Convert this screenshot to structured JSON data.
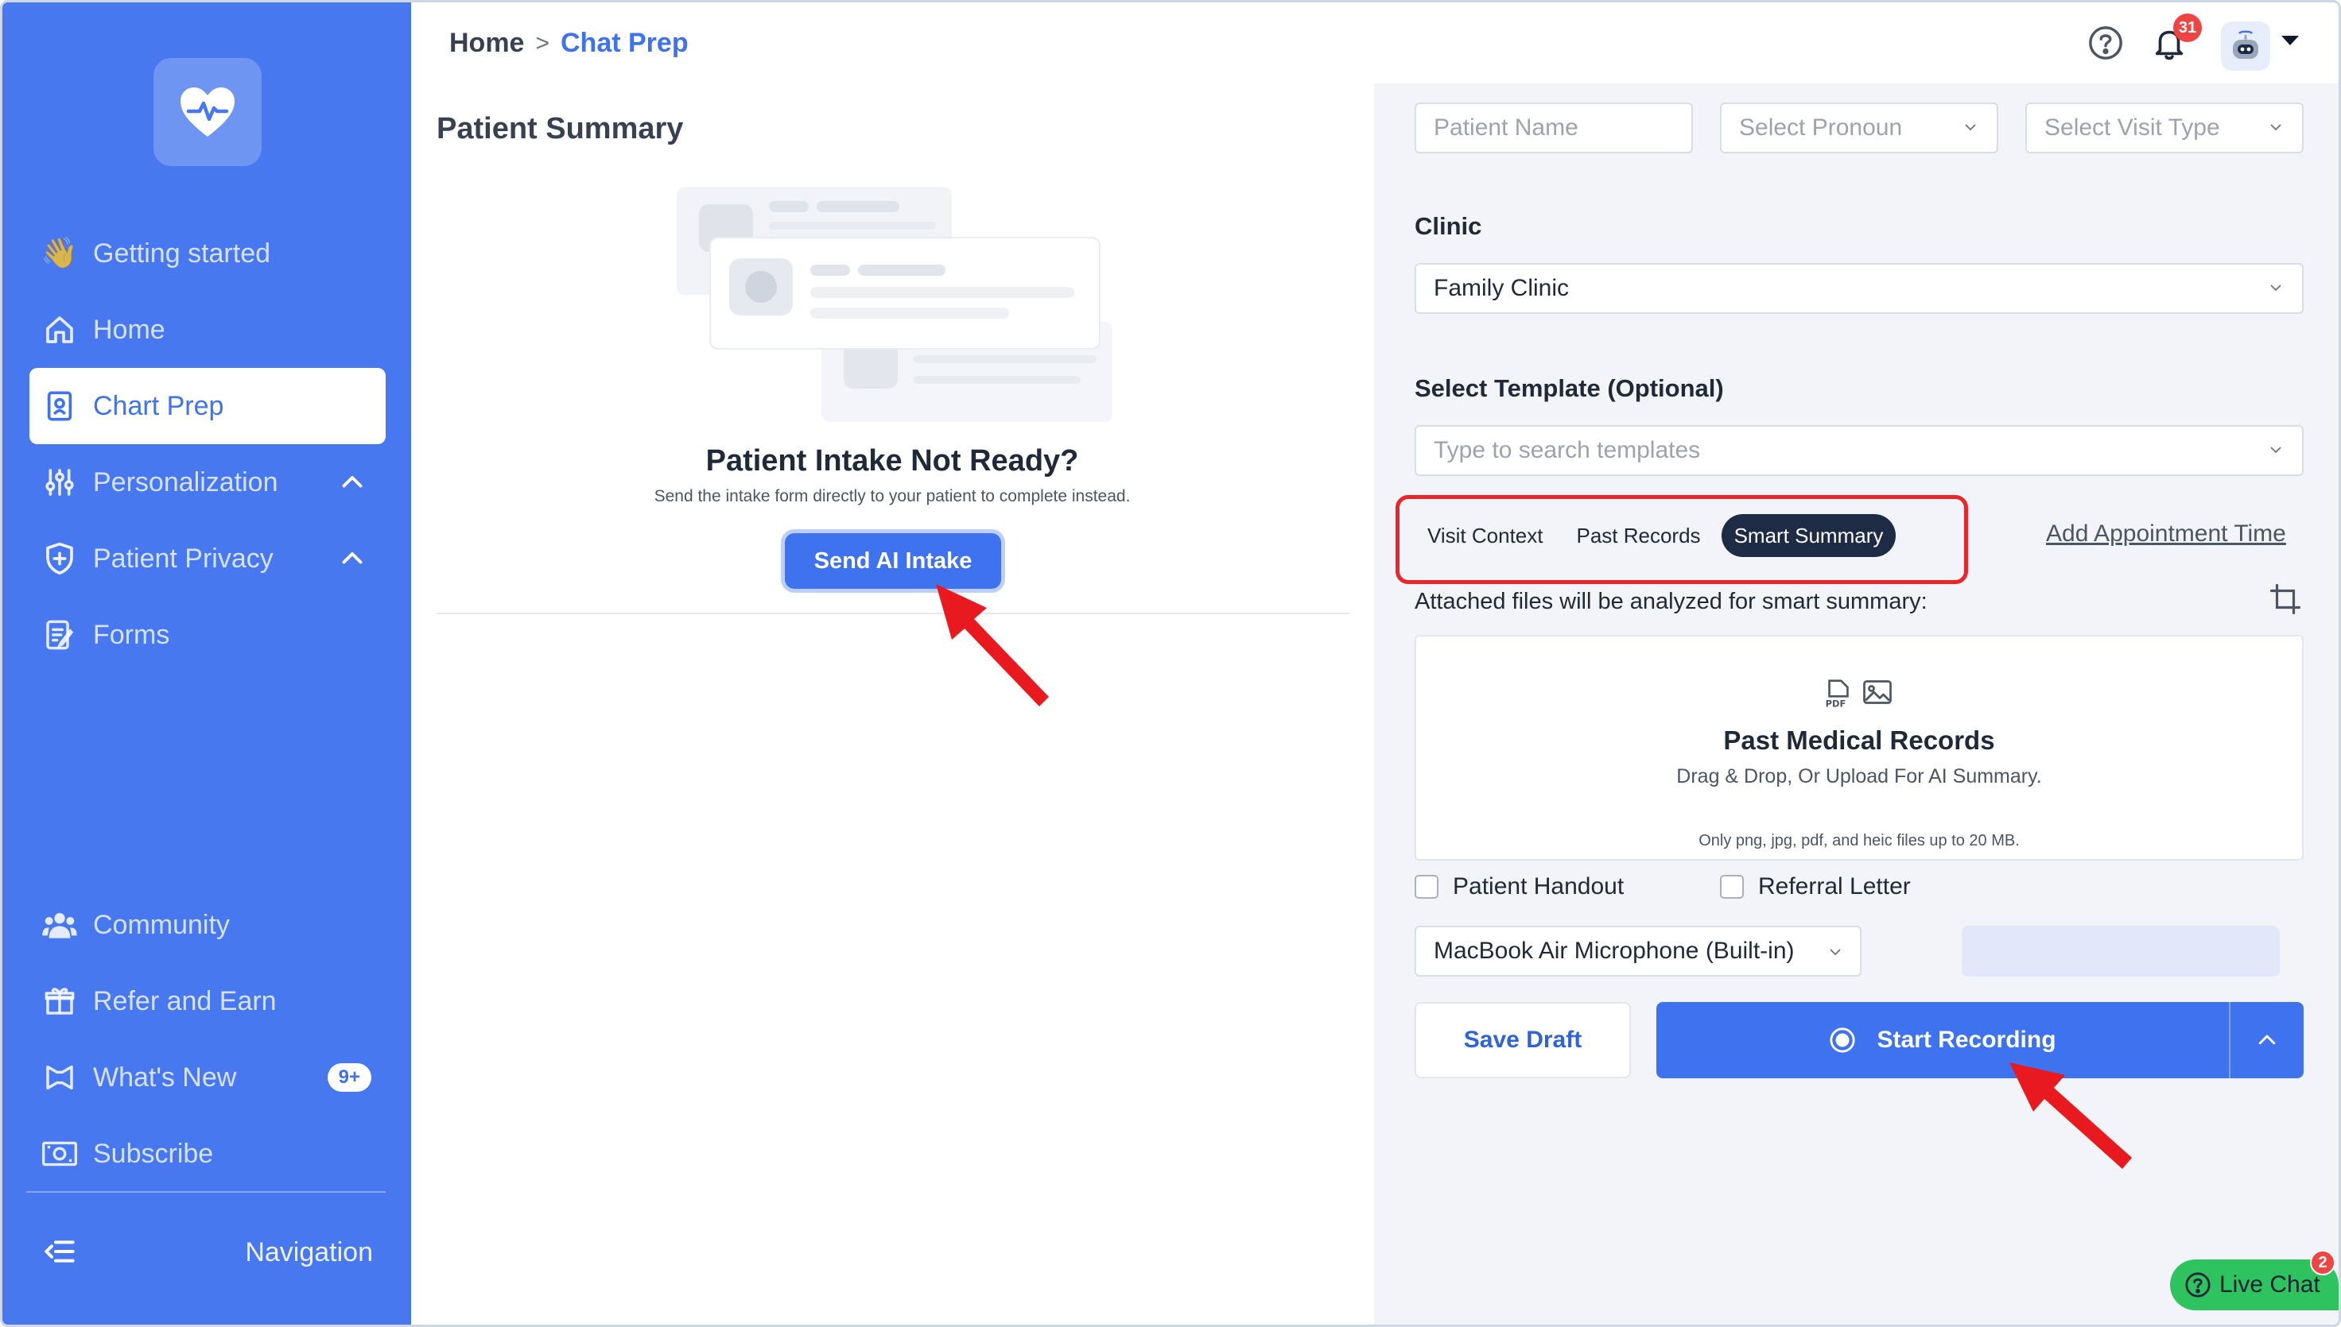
{
  "sidebar": {
    "items": [
      {
        "label": "Getting started",
        "icon": "waving-hand-icon"
      },
      {
        "label": "Home",
        "icon": "home-icon"
      },
      {
        "label": "Chart Prep",
        "icon": "clipboard-icon",
        "active": true
      },
      {
        "label": "Personalization",
        "icon": "sliders-icon"
      },
      {
        "label": "Patient Privacy",
        "icon": "shield-plus-icon"
      },
      {
        "label": "Forms",
        "icon": "form-icon"
      }
    ],
    "bottom_items": [
      {
        "label": "Community",
        "icon": "people-icon"
      },
      {
        "label": "Refer and Earn",
        "icon": "gift-icon"
      },
      {
        "label": "What's New",
        "icon": "megaphone-icon",
        "badge": "9+"
      },
      {
        "label": "Subscribe",
        "icon": "banknote-icon"
      }
    ],
    "collapse_label": "Navigation"
  },
  "header": {
    "breadcrumb_home": "Home",
    "breadcrumb_separator": ">",
    "breadcrumb_current": "Chat Prep",
    "notification_count": "31"
  },
  "left_panel": {
    "title": "Patient Summary",
    "intake_title": "Patient Intake Not Ready?",
    "intake_subtitle": "Send the intake form directly to your patient to complete instead.",
    "send_button": "Send AI Intake"
  },
  "right_panel": {
    "patient_name_placeholder": "Patient Name",
    "pronoun_placeholder": "Select Pronoun",
    "visit_type_placeholder": "Select Visit Type",
    "clinic_label": "Clinic",
    "clinic_value": "Family Clinic",
    "template_label": "Select Template (Optional)",
    "template_placeholder": "Type to search templates",
    "tabs": [
      "Visit Context",
      "Past Records",
      "Smart Summary"
    ],
    "active_tab": "Smart Summary",
    "add_appointment": "Add Appointment Time",
    "attached_label": "Attached files will be analyzed for smart summary:",
    "upload_title": "Past Medical Records",
    "upload_subtitle": "Drag & Drop, Or Upload For AI Summary.",
    "upload_note": "Only png, jpg, pdf, and heic files up to 20 MB.",
    "checkbox_handout": "Patient Handout",
    "checkbox_referral": "Referral Letter",
    "microphone": "MacBook Air Microphone (Built-in)",
    "save_draft": "Save Draft",
    "start_recording": "Start Recording"
  },
  "live_chat": {
    "label": "Live Chat",
    "badge": "2"
  },
  "colors": {
    "sidebar": "#4778f0",
    "accent": "#3f72ee",
    "highlight": "#e8262b",
    "dark_tab": "#1e2b45"
  }
}
